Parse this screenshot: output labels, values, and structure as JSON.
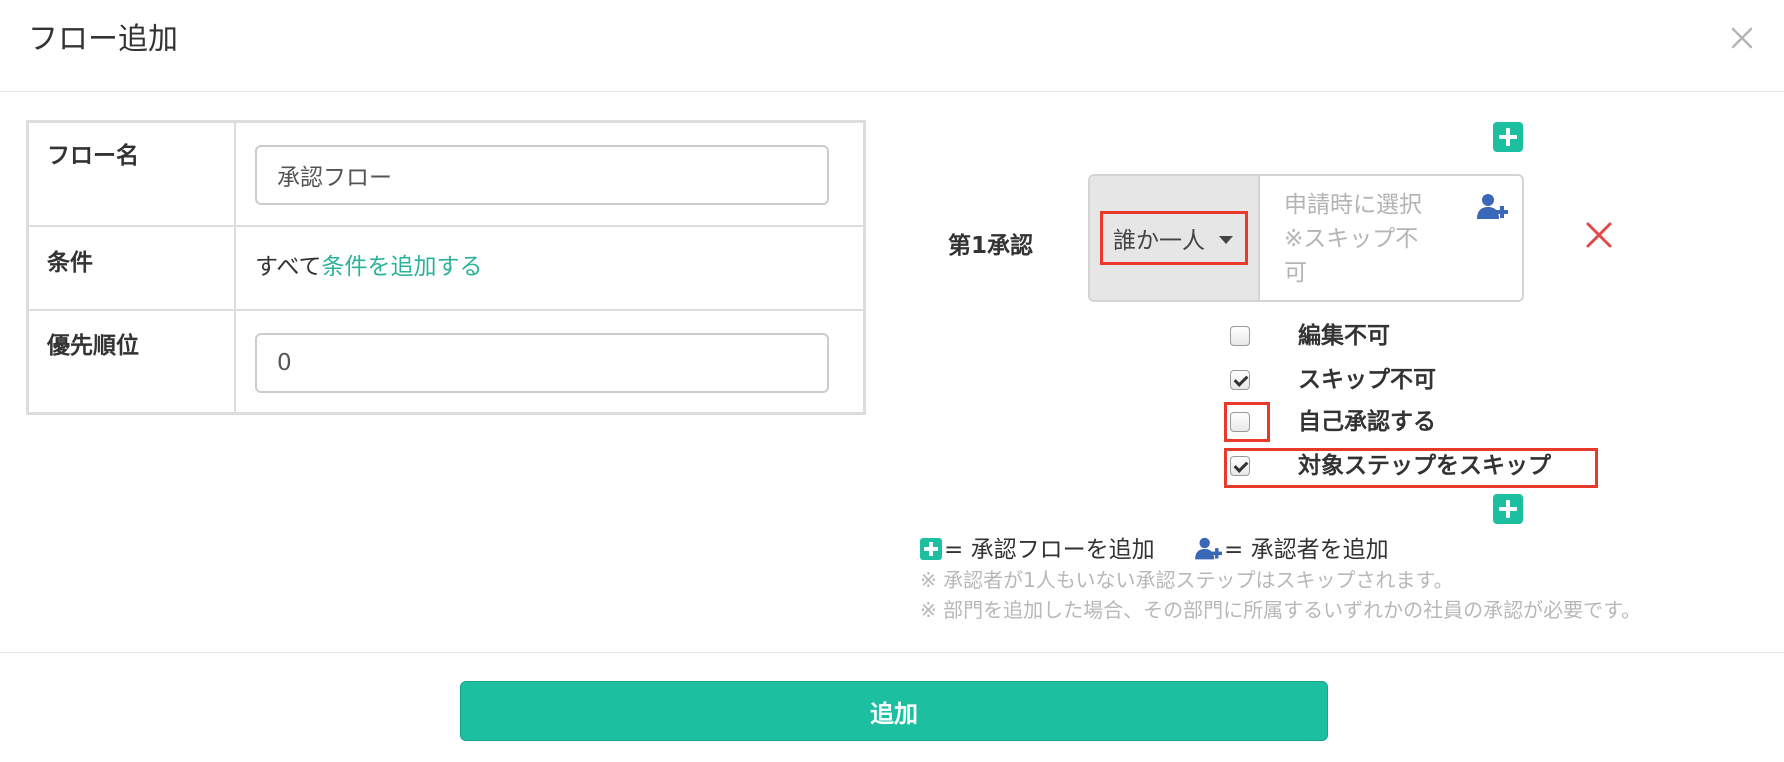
{
  "modal": {
    "title": "フロー追加",
    "close_label": "×"
  },
  "form": {
    "flow_name": {
      "label": "フロー名",
      "value": "承認フロー"
    },
    "conditions": {
      "label": "条件",
      "text": "すべて",
      "link": "条件を追加する"
    },
    "priority": {
      "label": "優先順位",
      "value": "0"
    }
  },
  "approval_flow": {
    "step": {
      "label": "第1承認",
      "approver_type": "誰か一人",
      "placeholder_lines": [
        "申請時に選択",
        "※スキップ不",
        "可"
      ]
    },
    "options": [
      {
        "label": "編集不可",
        "checked": false
      },
      {
        "label": "スキップ不可",
        "checked": true
      },
      {
        "label": "自己承認する",
        "checked": false
      },
      {
        "label": "対象ステップをスキップ",
        "checked": true
      }
    ]
  },
  "legend": {
    "add_flow": "= 承認フローを追加",
    "add_approver": "= 承認者を追加"
  },
  "notes": [
    "※ 承認者が1人もいない承認ステップはスキップされます。",
    "※ 部門を追加した場合、その部門に所属するいずれかの社員の承認が必要です。"
  ],
  "footer": {
    "submit_label": "追加"
  },
  "colors": {
    "accent": "#1dbfa1",
    "link": "#2bb29a",
    "highlight": "#e8392b",
    "user_icon": "#3a67b8"
  }
}
